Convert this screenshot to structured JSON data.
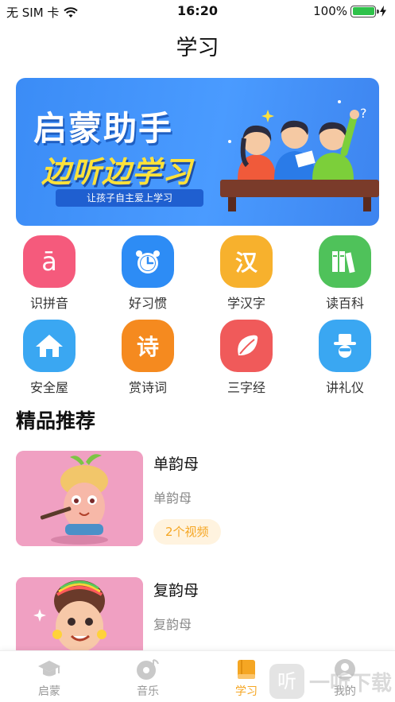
{
  "status": {
    "carrier": "无 SIM 卡",
    "time": "16:20",
    "battery": "100%",
    "battery_level": 1.0
  },
  "page_title": "学习",
  "banner": {
    "title": "启蒙助手",
    "subtitle": "边听边学习",
    "tagline": "让孩子自主爱上学习"
  },
  "categories": [
    {
      "label": "识拼音",
      "icon": "pinyin-a-icon",
      "color": "#f55a7c",
      "glyph": "ā"
    },
    {
      "label": "好习惯",
      "icon": "alarm-clock-icon",
      "color": "#2d8cf5"
    },
    {
      "label": "学汉字",
      "icon": "hanzi-icon",
      "color": "#f7b12d",
      "glyph": "汉"
    },
    {
      "label": "读百科",
      "icon": "books-icon",
      "color": "#4fc25a"
    },
    {
      "label": "安全屋",
      "icon": "house-icon",
      "color": "#3aa7f2"
    },
    {
      "label": "赏诗词",
      "icon": "poem-icon",
      "color": "#f58a1f",
      "glyph": "诗"
    },
    {
      "label": "三字经",
      "icon": "leaf-icon",
      "color": "#f05a5a"
    },
    {
      "label": "讲礼仪",
      "icon": "gentleman-icon",
      "color": "#3aa7f2"
    }
  ],
  "section_title": "精品推荐",
  "recommendations": [
    {
      "title": "单韵母",
      "subtitle": "单韵母",
      "badge": "2个视频"
    },
    {
      "title": "复韵母",
      "subtitle": "复韵母",
      "badge": ""
    }
  ],
  "tabs": [
    {
      "label": "启蒙",
      "icon": "graduation-cap-icon",
      "active": false
    },
    {
      "label": "音乐",
      "icon": "music-disc-icon",
      "active": false
    },
    {
      "label": "学习",
      "icon": "book-icon",
      "active": true
    },
    {
      "label": "我的",
      "icon": "user-icon",
      "active": false
    }
  ],
  "watermark": {
    "text": "一听下载",
    "mark": "听"
  },
  "colors": {
    "accent": "#f5a623",
    "banner_blue": "#4a9bff"
  }
}
